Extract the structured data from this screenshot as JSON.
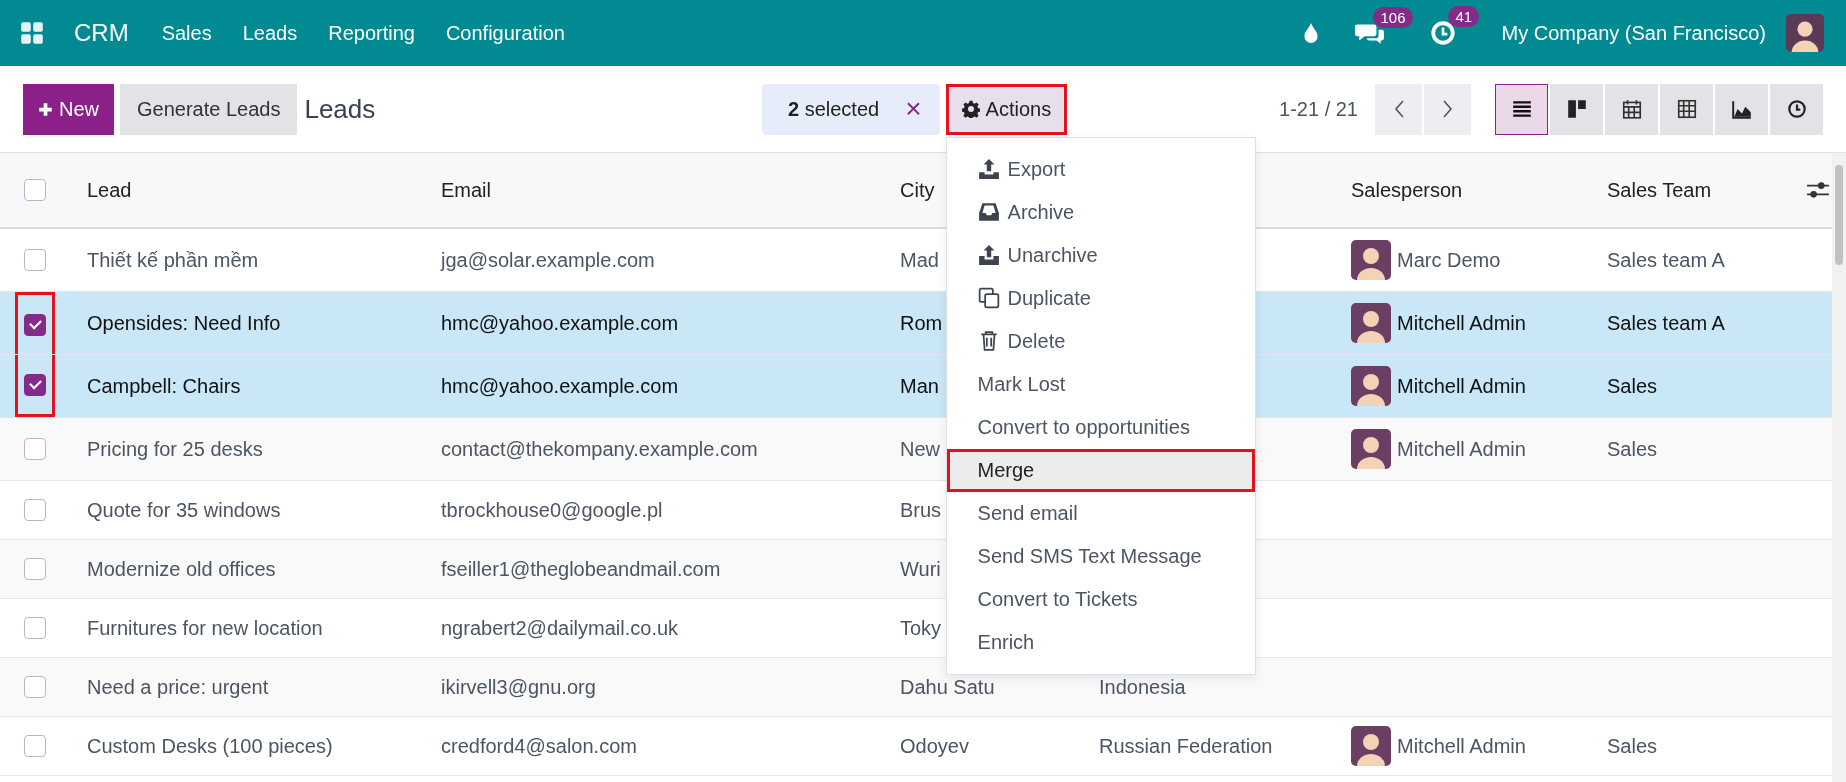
{
  "topbar": {
    "app": "CRM",
    "menu": [
      "Sales",
      "Leads",
      "Reporting",
      "Configuration"
    ],
    "messages_badge": "106",
    "activities_badge": "41",
    "company": "My Company (San Francisco)"
  },
  "toolbar": {
    "new_label": "New",
    "generate_label": "Generate Leads",
    "title": "Leads",
    "selected_count": "2",
    "selected_text": "selected",
    "close": "×",
    "actions_label": "Actions",
    "actions_highlighted": true,
    "pager": "1-21 / 21",
    "views": [
      {
        "kind": "list",
        "selected": true
      },
      {
        "kind": "kanban",
        "selected": false
      },
      {
        "kind": "calendar",
        "selected": false
      },
      {
        "kind": "pivot",
        "selected": false
      },
      {
        "kind": "graph",
        "selected": false
      },
      {
        "kind": "activity",
        "selected": false
      }
    ]
  },
  "actions_menu": [
    {
      "label": "Export",
      "kind": "export",
      "highlighted": false
    },
    {
      "label": "Archive",
      "kind": "archive",
      "highlighted": false
    },
    {
      "label": "Unarchive",
      "kind": "unarchive",
      "highlighted": false
    },
    {
      "label": "Duplicate",
      "kind": "duplicate",
      "highlighted": false
    },
    {
      "label": "Delete",
      "kind": "delete",
      "highlighted": false
    },
    {
      "label": "Mark Lost",
      "highlighted": false
    },
    {
      "label": "Convert to opportunities",
      "highlighted": false
    },
    {
      "label": "Merge",
      "highlighted": true
    },
    {
      "label": "Send email",
      "highlighted": false
    },
    {
      "label": "Send SMS Text Message",
      "highlighted": false
    },
    {
      "label": "Convert to Tickets",
      "highlighted": false
    },
    {
      "label": "Enrich",
      "highlighted": false
    }
  ],
  "table": {
    "all_selected": false,
    "columns": [
      "Lead",
      "Email",
      "City",
      "Salesperson",
      "Sales Team"
    ],
    "rows": [
      {
        "selected": false,
        "marked": false,
        "lead": "Thiết kế phần mềm",
        "email": "jga@solar.example.com",
        "city": "Mad",
        "salesperson": "Marc Demo",
        "team": "Sales team A"
      },
      {
        "selected": true,
        "marked": true,
        "lead": "Opensides: Need Info",
        "email": "hmc@yahoo.example.com",
        "city": "Rom",
        "salesperson": "Mitchell Admin",
        "team": "Sales team A"
      },
      {
        "selected": true,
        "marked": true,
        "lead": "Campbell: Chairs",
        "email": "hmc@yahoo.example.com",
        "city": "Man",
        "salesperson": "Mitchell Admin",
        "team": "Sales"
      },
      {
        "selected": false,
        "marked": false,
        "lead": "Pricing for 25 desks",
        "email": "contact@thekompany.example.com",
        "city": "New",
        "salesperson": "Mitchell Admin",
        "team": "Sales"
      },
      {
        "selected": false,
        "marked": false,
        "lead": "Quote for 35 windows",
        "email": "tbrockhouse0@google.pl",
        "city": "Brus"
      },
      {
        "selected": false,
        "marked": false,
        "lead": "Modernize old offices",
        "email": "fseiller1@theglobeandmail.com",
        "city": "Wuri"
      },
      {
        "selected": false,
        "marked": false,
        "lead": "Furnitures for new location",
        "email": "ngrabert2@dailymail.co.uk",
        "city": "Toky"
      },
      {
        "selected": false,
        "marked": false,
        "lead": "Need a price: urgent",
        "email": "ikirvell3@gnu.org",
        "city": "Dahu Satu",
        "country": "Indonesia"
      },
      {
        "selected": false,
        "marked": false,
        "lead": "Custom Desks (100 pieces)",
        "email": "credford4@salon.com",
        "city": "Odoyev",
        "country": "Russian Federation",
        "salesperson": "Mitchell Admin",
        "team": "Sales"
      }
    ]
  }
}
